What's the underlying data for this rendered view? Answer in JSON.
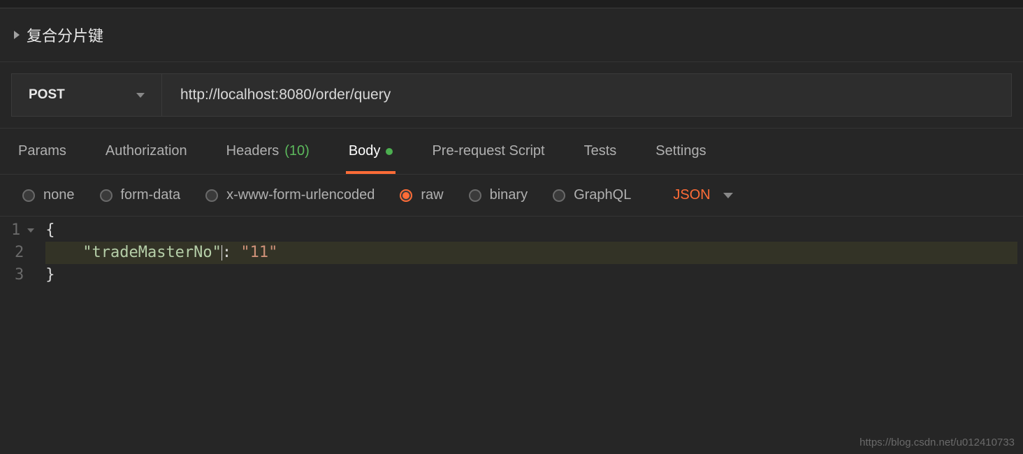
{
  "title": "复合分片键",
  "request": {
    "method": "POST",
    "url": "http://localhost:8080/order/query"
  },
  "tabs": {
    "params": "Params",
    "authorization": "Authorization",
    "headers": "Headers",
    "headers_count": "(10)",
    "body": "Body",
    "prerequest": "Pre-request Script",
    "tests": "Tests",
    "settings": "Settings"
  },
  "body_types": {
    "none": "none",
    "form_data": "form-data",
    "urlencoded": "x-www-form-urlencoded",
    "raw": "raw",
    "binary": "binary",
    "graphql": "GraphQL"
  },
  "format": "JSON",
  "code": {
    "line1": "{",
    "key": "\"tradeMasterNo\"",
    "sep": ": ",
    "value": "\"11\"",
    "line3": "}",
    "gutter1": "1",
    "gutter2": "2",
    "gutter3": "3"
  },
  "watermark": "https://blog.csdn.net/u012410733"
}
